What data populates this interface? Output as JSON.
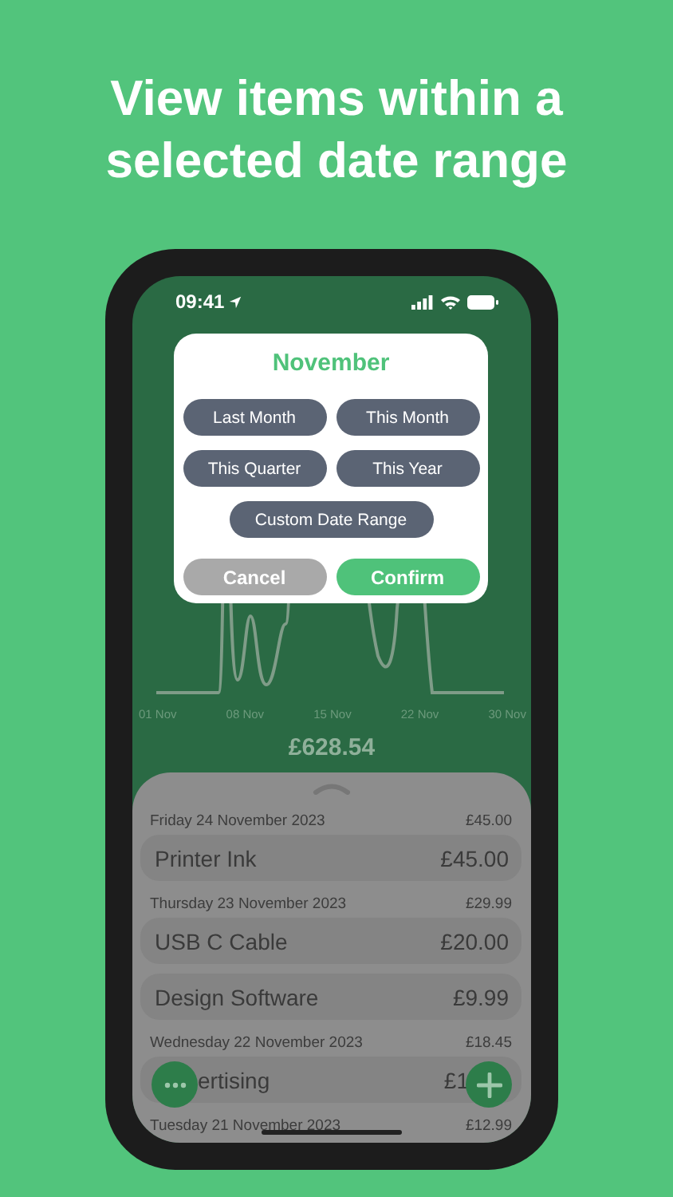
{
  "headline": [
    "View items within a",
    "selected date range"
  ],
  "status_bar": {
    "time": "09:41"
  },
  "dialog": {
    "title": "November",
    "presets": [
      {
        "label": "Last Month"
      },
      {
        "label": "This Month"
      },
      {
        "label": "This Quarter"
      },
      {
        "label": "This Year"
      }
    ],
    "custom": "Custom Date Range",
    "cancel": "Cancel",
    "confirm": "Confirm"
  },
  "chart": {
    "x_labels": [
      "01 Nov",
      "08 Nov",
      "15 Nov",
      "22 Nov",
      "30 Nov"
    ]
  },
  "total": "£628.54",
  "days": [
    {
      "date": "Friday 24 November 2023",
      "total": "£45.00",
      "items": [
        {
          "name": "Printer Ink",
          "amount": "£45.00"
        }
      ]
    },
    {
      "date": "Thursday 23 November 2023",
      "total": "£29.99",
      "items": [
        {
          "name": "USB C Cable",
          "amount": "£20.00"
        },
        {
          "name": "Design Software",
          "amount": "£9.99"
        }
      ]
    },
    {
      "date": "Wednesday 22 November 2023",
      "total": "£18.45",
      "items": [
        {
          "name": "ertising",
          "amount": "£1"
        }
      ]
    },
    {
      "date": "Tuesday 21 November 2023",
      "total": "£12.99"
    }
  ]
}
